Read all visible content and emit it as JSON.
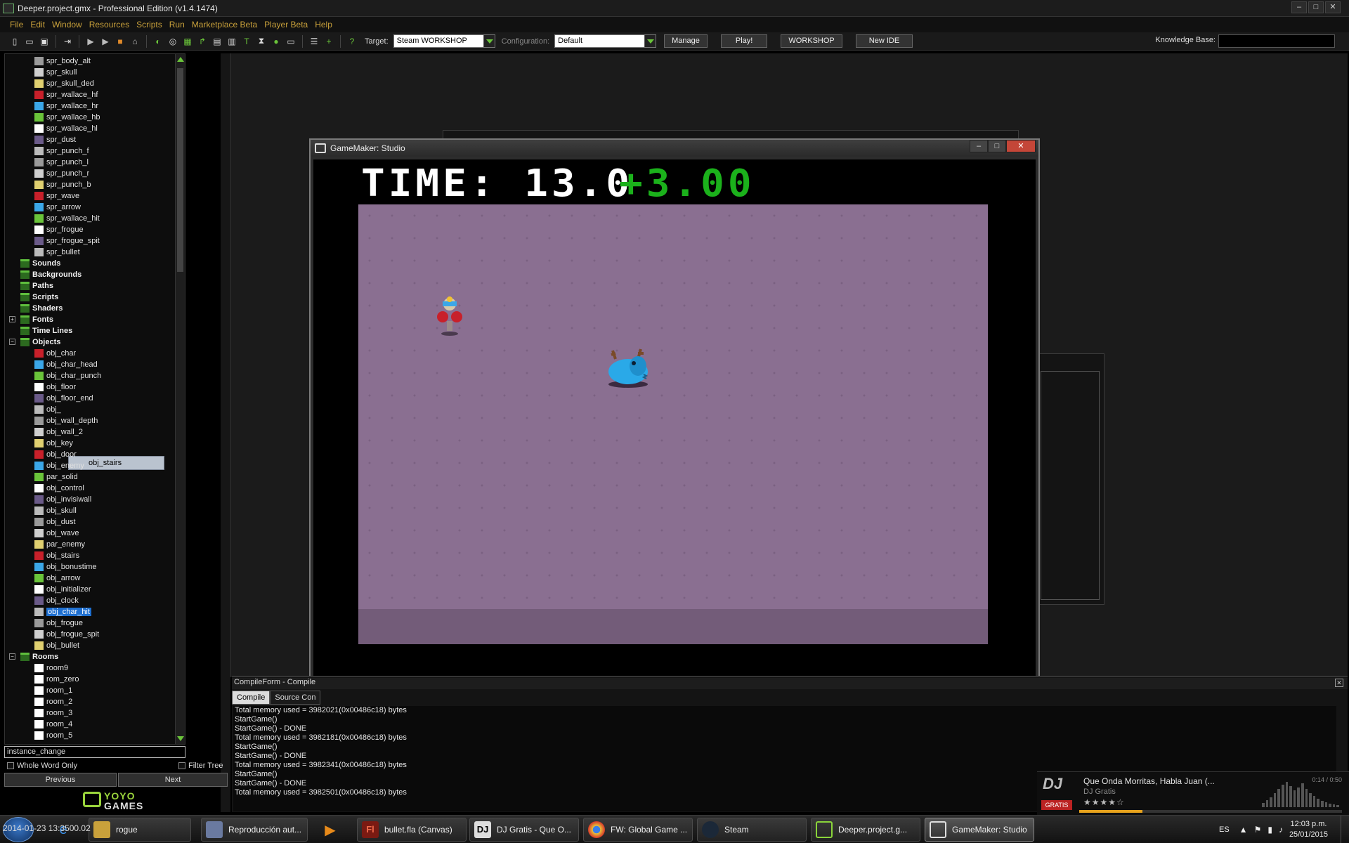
{
  "window": {
    "title": "Deeper.project.gmx  -  Professional Edition (v1.4.1474)"
  },
  "menu": [
    "File",
    "Edit",
    "Window",
    "Resources",
    "Scripts",
    "Run",
    "Marketplace Beta",
    "Player Beta",
    "Help"
  ],
  "toolbar": {
    "target_label": "Target:",
    "target_value": "Steam WORKSHOP",
    "config_label": "Configuration:",
    "config_value": "Default",
    "manage": "Manage",
    "play": "Play!",
    "workshop": "WORKSHOP",
    "new_ide": "New IDE",
    "kb_label": "Knowledge Base:"
  },
  "tree": {
    "sprites": [
      "spr_body_alt",
      "spr_skull",
      "spr_skull_ded",
      "spr_wallace_hf",
      "spr_wallace_hr",
      "spr_wallace_hb",
      "spr_wallace_hl",
      "spr_dust",
      "spr_punch_f",
      "spr_punch_l",
      "spr_punch_r",
      "spr_punch_b",
      "spr_wave",
      "spr_arrow",
      "spr_wallace_hit",
      "spr_frogue",
      "spr_frogue_spit",
      "spr_bullet"
    ],
    "folders": [
      "Sounds",
      "Backgrounds",
      "Paths",
      "Scripts",
      "Shaders",
      "Fonts",
      "Time Lines",
      "Objects"
    ],
    "objects": [
      "obj_char",
      "obj_char_head",
      "obj_char_punch",
      "obj_floor",
      "obj_floor_end",
      "obj_",
      "obj_wall_depth",
      "obj_wall_2",
      "obj_key",
      "obj_door",
      "obj_enemy",
      "par_solid",
      "obj_control",
      "obj_invisiwall",
      "obj_skull",
      "obj_dust",
      "obj_wave",
      "par_enemy",
      "obj_stairs",
      "obj_bonustime",
      "obj_arrow",
      "obj_initializer",
      "obj_clock",
      "obj_char_hit",
      "obj_frogue",
      "obj_frogue_spit",
      "obj_bullet"
    ],
    "rooms_label": "Rooms",
    "rooms": [
      "room9",
      "rom_zero",
      "room_1",
      "room_2",
      "room_3",
      "room_4",
      "room_5"
    ],
    "drag_tip": "obj_stairs",
    "selected": "obj_char_hit"
  },
  "search": {
    "value": "instance_change",
    "whole_word": "Whole Word Only",
    "filter_tree": "Filter Tree",
    "previous": "Previous",
    "next": "Next"
  },
  "logo": {
    "line1": "YOYO",
    "line2": "GAMES"
  },
  "game": {
    "title": "GameMaker: Studio",
    "time_label": "TIME: 13.0",
    "bonus_label": "+3.00"
  },
  "console": {
    "header": "CompileForm - Compile",
    "tabs": [
      "Compile",
      "Source Con"
    ],
    "lines": [
      "Total memory used = 3982021(0x00486c18) bytes",
      "StartGame()",
      "StartGame() - DONE",
      "Total memory used = 3982181(0x00486c18) bytes",
      "StartGame()",
      "StartGame() - DONE",
      "Total memory used = 3982341(0x00486c18) bytes",
      "StartGame()",
      "StartGame() - DONE",
      "Total memory used = 3982501(0x00486c18) bytes"
    ]
  },
  "media": {
    "logo": "DJ",
    "logo_sub": "GRATIS",
    "title": "Que Onda Morritas, Habla Juan (...",
    "artist": "DJ Gratis",
    "stars": "★★★★☆",
    "time": "0:14 / 0:50",
    "progress": 0.24
  },
  "taskbar": {
    "overlay": "2014-01-23 13:3500.02",
    "items": [
      "rogue",
      "Reproducción aut...",
      "bullet.fla (Canvas)",
      "DJ Gratis - Que O...",
      "FW: Global Game ...",
      "Steam",
      "Deeper.project.g...",
      "GameMaker: Studio"
    ],
    "lang": "ES",
    "time": "12:03 p.m.",
    "date": "25/01/2015"
  }
}
